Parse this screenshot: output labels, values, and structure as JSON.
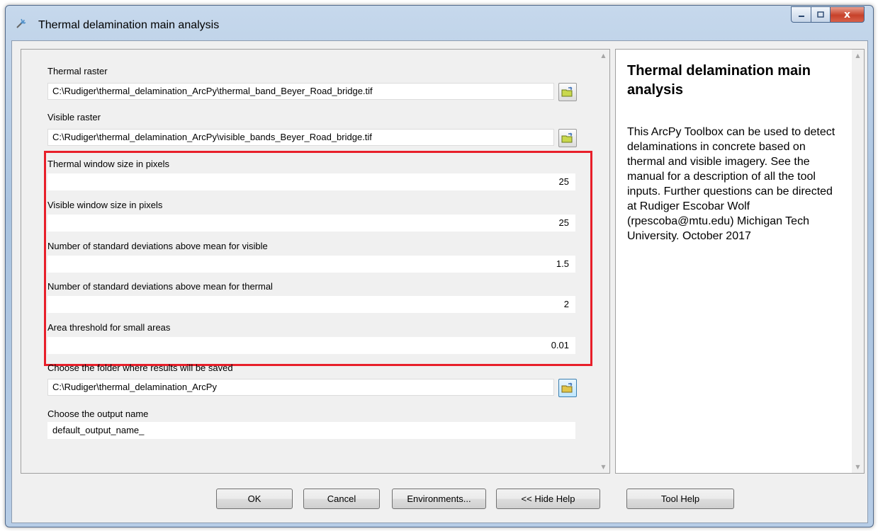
{
  "window": {
    "title": "Thermal delamination main analysis",
    "icon": "toolbox-script-icon",
    "controls": {
      "minimize": "minimize-icon",
      "maximize": "maximize-icon",
      "close": "x"
    }
  },
  "form": {
    "thermal_raster": {
      "label": "Thermal raster",
      "value": "C:\\Rudiger\\thermal_delamination_ArcPy\\thermal_band_Beyer_Road_bridge.tif"
    },
    "visible_raster": {
      "label": "Visible raster",
      "value": "C:\\Rudiger\\thermal_delamination_ArcPy\\visible_bands_Beyer_Road_bridge.tif"
    },
    "thermal_window": {
      "label": "Thermal window size in pixels",
      "value": "25"
    },
    "visible_window": {
      "label": "Visible window size in pixels",
      "value": "25"
    },
    "std_visible": {
      "label": "Number of standard deviations above mean for visible",
      "value": "1.5"
    },
    "std_thermal": {
      "label": "Number of standard deviations above mean for thermal",
      "value": "2"
    },
    "area_threshold": {
      "label": "Area threshold for small areas",
      "value": "0.01"
    },
    "output_folder": {
      "label": "Choose the folder where results will be saved",
      "value": "C:\\Rudiger\\thermal_delamination_ArcPy"
    },
    "output_name": {
      "label": "Choose the output name",
      "value": "default_output_name_"
    }
  },
  "highlight_color": "#e81f2a",
  "help": {
    "title": "Thermal delamination main analysis",
    "body": "This ArcPy Toolbox can be used to detect delaminations in concrete based on thermal and visible imagery. See the manual for a description of all the tool inputs. Further questions can be directed at Rudiger Escobar Wolf (rpescoba@mtu.edu) Michigan Tech University. October 2017"
  },
  "buttons": {
    "ok": "OK",
    "cancel": "Cancel",
    "environments": "Environments...",
    "hide_help": "<< Hide Help",
    "tool_help": "Tool Help"
  }
}
